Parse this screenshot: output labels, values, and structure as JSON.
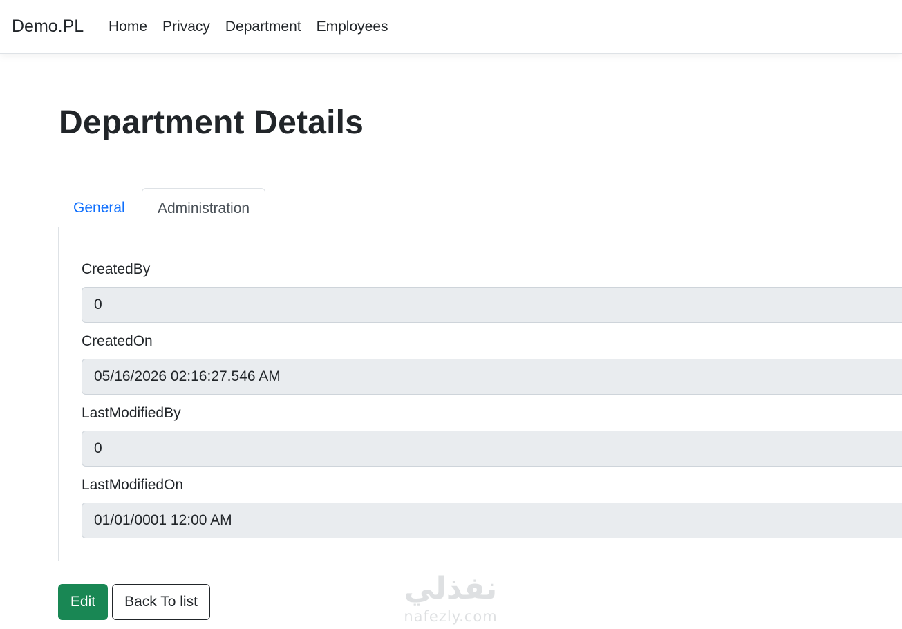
{
  "navbar": {
    "brand": "Demo.PL",
    "links": [
      "Home",
      "Privacy",
      "Department",
      "Employees"
    ]
  },
  "page": {
    "title": "Department Details"
  },
  "tabs": {
    "general": "General",
    "administration": "Administration",
    "active": "Administration"
  },
  "fields": [
    {
      "label": "CreatedBy",
      "value": "0"
    },
    {
      "label": "CreatedOn",
      "value": "05/16/2026 02:16:27.546 AM"
    },
    {
      "label": "LastModifiedBy",
      "value": "0"
    },
    {
      "label": "LastModifiedOn",
      "value": "01/01/0001 12:00 AM"
    }
  ],
  "actions": {
    "edit_label": "Edit",
    "back_label": "Back To list"
  },
  "watermark": {
    "arabic": "نفذلي",
    "latin": "nafezly.com"
  },
  "colors": {
    "primary_link": "#0d6efd",
    "edit_button": "#198754",
    "readonly_field_bg": "#e9ecef"
  }
}
